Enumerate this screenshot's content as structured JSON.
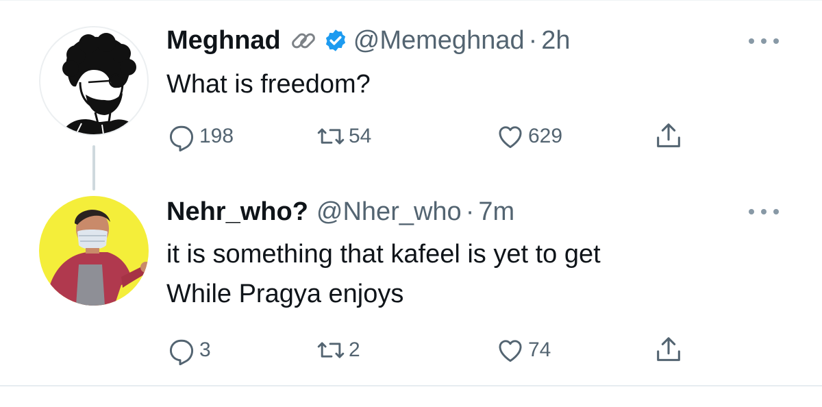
{
  "tweets": [
    {
      "display_name": "Meghnad",
      "name_emoji": "link-icon",
      "verified": true,
      "handle": "@Memeghnad",
      "time": "2h",
      "text_lines": [
        "What is freedom?"
      ],
      "replies": "198",
      "retweets": "54",
      "likes": "629"
    },
    {
      "display_name": "Nehr_who?",
      "verified": false,
      "handle": "@Nher_who",
      "time": "7m",
      "text_lines": [
        "it is something that kafeel is yet to get",
        "While Pragya enjoys"
      ],
      "replies": "3",
      "retweets": "2",
      "likes": "74"
    }
  ],
  "separator": "·",
  "colors": {
    "verified": "#1d9bf0",
    "muted": "#536471",
    "text": "#0f1419",
    "avatar2_bg": "#f4ee3a"
  }
}
